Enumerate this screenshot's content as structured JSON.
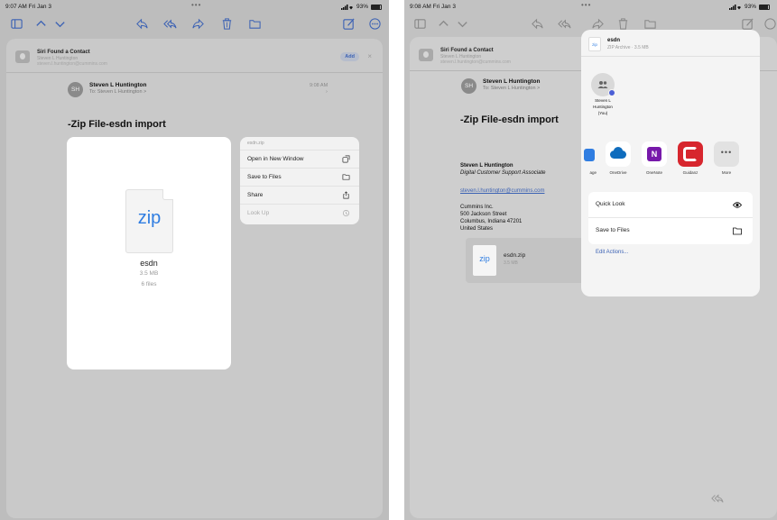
{
  "left": {
    "status": {
      "time": "9:07 AM  Fri Jan 3",
      "dots": "•••",
      "battery": "93%",
      "battery_level": 0.93
    },
    "siri": {
      "title": "Siri Found a Contact",
      "name": "Steven L Huntington",
      "email": "steven.l.huntington@cummins.com",
      "add": "Add",
      "close": "×"
    },
    "sender": {
      "avatar": "SH",
      "name": "Steven L Huntington",
      "to_prefix": "To:",
      "to": "Steven L Huntington >",
      "time": "9:08 AM"
    },
    "subject": "-Zip File-esdn import",
    "preview": {
      "doc_label": "zip",
      "name": "esdn",
      "size": "3.5 MB",
      "files": "6 files"
    },
    "context_menu": {
      "header": "esdn.zip",
      "items": [
        {
          "label": "Open in New Window",
          "icon": "new-window-icon"
        },
        {
          "label": "Save to Files",
          "icon": "folder-icon"
        },
        {
          "label": "Share",
          "icon": "share-icon"
        },
        {
          "label": "Look Up",
          "icon": "look-up-icon"
        }
      ]
    }
  },
  "right": {
    "status": {
      "time": "9:08 AM  Fri Jan 3",
      "dots": "•••",
      "battery": "93%",
      "battery_level": 0.93
    },
    "siri": {
      "title": "Siri Found a Contact",
      "name": "Steven L Huntington",
      "email": "steven.l.huntington@cummins.com"
    },
    "sender": {
      "avatar": "SH",
      "name": "Steven L Huntington",
      "to_prefix": "To:",
      "to": "Steven L Huntington >"
    },
    "subject": "-Zip File-esdn import",
    "signature": {
      "name": "Steven L Huntington",
      "title": "Digital Customer Support Associate",
      "email": "steven.l.huntington@cummins.com",
      "company": "Cummins Inc.",
      "street": "500 Jackson Street",
      "city": "Columbus, Indiana 47201",
      "country": "United States"
    },
    "attachment": {
      "doc_label": "zip",
      "name": "esdn.zip",
      "size": "3.5 MB"
    },
    "share_sheet": {
      "file_icon_label": "zip",
      "title": "esdn",
      "subtitle": "ZIP Archive · 3.5 MB",
      "person": {
        "name_line1": "Steven L",
        "name_line2": "Huntington",
        "name_line3": "(You)"
      },
      "apps": [
        {
          "label": "age"
        },
        {
          "label": "OneDrive",
          "color": "#0f6cbd"
        },
        {
          "label": "OneNote",
          "color": "#7719aa"
        },
        {
          "label": "Guidanz",
          "color": "#d7262e"
        },
        {
          "label": "More"
        }
      ],
      "actions": [
        {
          "label": "Quick Look",
          "icon": "eye-icon"
        },
        {
          "label": "Save to Files",
          "icon": "folder-icon"
        }
      ],
      "edit_actions": "Edit Actions..."
    }
  }
}
